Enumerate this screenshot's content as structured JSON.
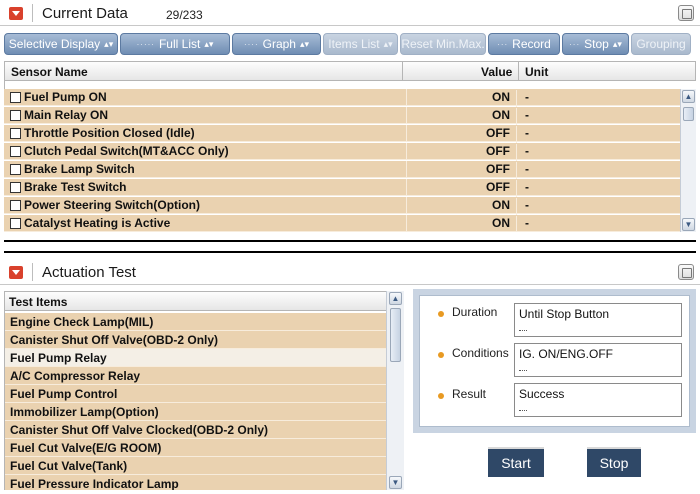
{
  "current_data": {
    "title": "Current Data",
    "count": "29/233"
  },
  "toolbar": {
    "items": [
      {
        "label": "Selective Display",
        "disabled": false
      },
      {
        "label": "Full List",
        "disabled": false
      },
      {
        "label": "Graph",
        "disabled": false
      },
      {
        "label": "Items List",
        "disabled": true
      },
      {
        "label": "Reset Min.Max.",
        "disabled": true
      },
      {
        "label": "Record",
        "disabled": false
      },
      {
        "label": "Stop",
        "disabled": false
      },
      {
        "label": "Grouping",
        "disabled": true
      }
    ]
  },
  "sensor_table": {
    "headers": {
      "name": "Sensor Name",
      "value": "Value",
      "unit": "Unit"
    },
    "rows": [
      {
        "name": "Fuel Pump ON",
        "value": "ON",
        "unit": "-"
      },
      {
        "name": "Main Relay ON",
        "value": "ON",
        "unit": "-"
      },
      {
        "name": "Throttle Position Closed (Idle)",
        "value": "OFF",
        "unit": "-"
      },
      {
        "name": "Clutch Pedal Switch(MT&ACC Only)",
        "value": "OFF",
        "unit": "-"
      },
      {
        "name": "Brake Lamp Switch",
        "value": "OFF",
        "unit": "-"
      },
      {
        "name": "Brake Test Switch",
        "value": "OFF",
        "unit": "-"
      },
      {
        "name": "Power Steering Switch(Option)",
        "value": "ON",
        "unit": "-"
      },
      {
        "name": "Catalyst Heating is Active",
        "value": "ON",
        "unit": "-"
      }
    ]
  },
  "actuation_test": {
    "title": "Actuation Test",
    "list_header": "Test Items",
    "items": [
      "Engine Check Lamp(MIL)",
      "Canister Shut Off Valve(OBD-2 Only)",
      "Fuel Pump Relay",
      "A/C Compressor Relay",
      "Fuel Pump Control",
      "Immobilizer Lamp(Option)",
      "Canister Shut Off Valve Clocked(OBD-2 Only)",
      "Fuel Cut Valve(E/G ROOM)",
      "Fuel Cut Valve(Tank)",
      "Fuel Pressure Indicator Lamp"
    ],
    "selected_index": 2,
    "fields": {
      "duration_label": "Duration",
      "duration_value": "Until Stop Button",
      "conditions_label": "Conditions",
      "conditions_value": "IG. ON/ENG.OFF",
      "result_label": "Result",
      "result_value": "Success"
    },
    "start_label": "Start",
    "stop_label": "Stop"
  },
  "colors": {
    "row_bg": "#ead2b0",
    "toolbar_button": "#6f8db3",
    "action_button": "#2f4867",
    "collapse_icon": "#d9412c",
    "field_bullet": "#e89a22"
  }
}
